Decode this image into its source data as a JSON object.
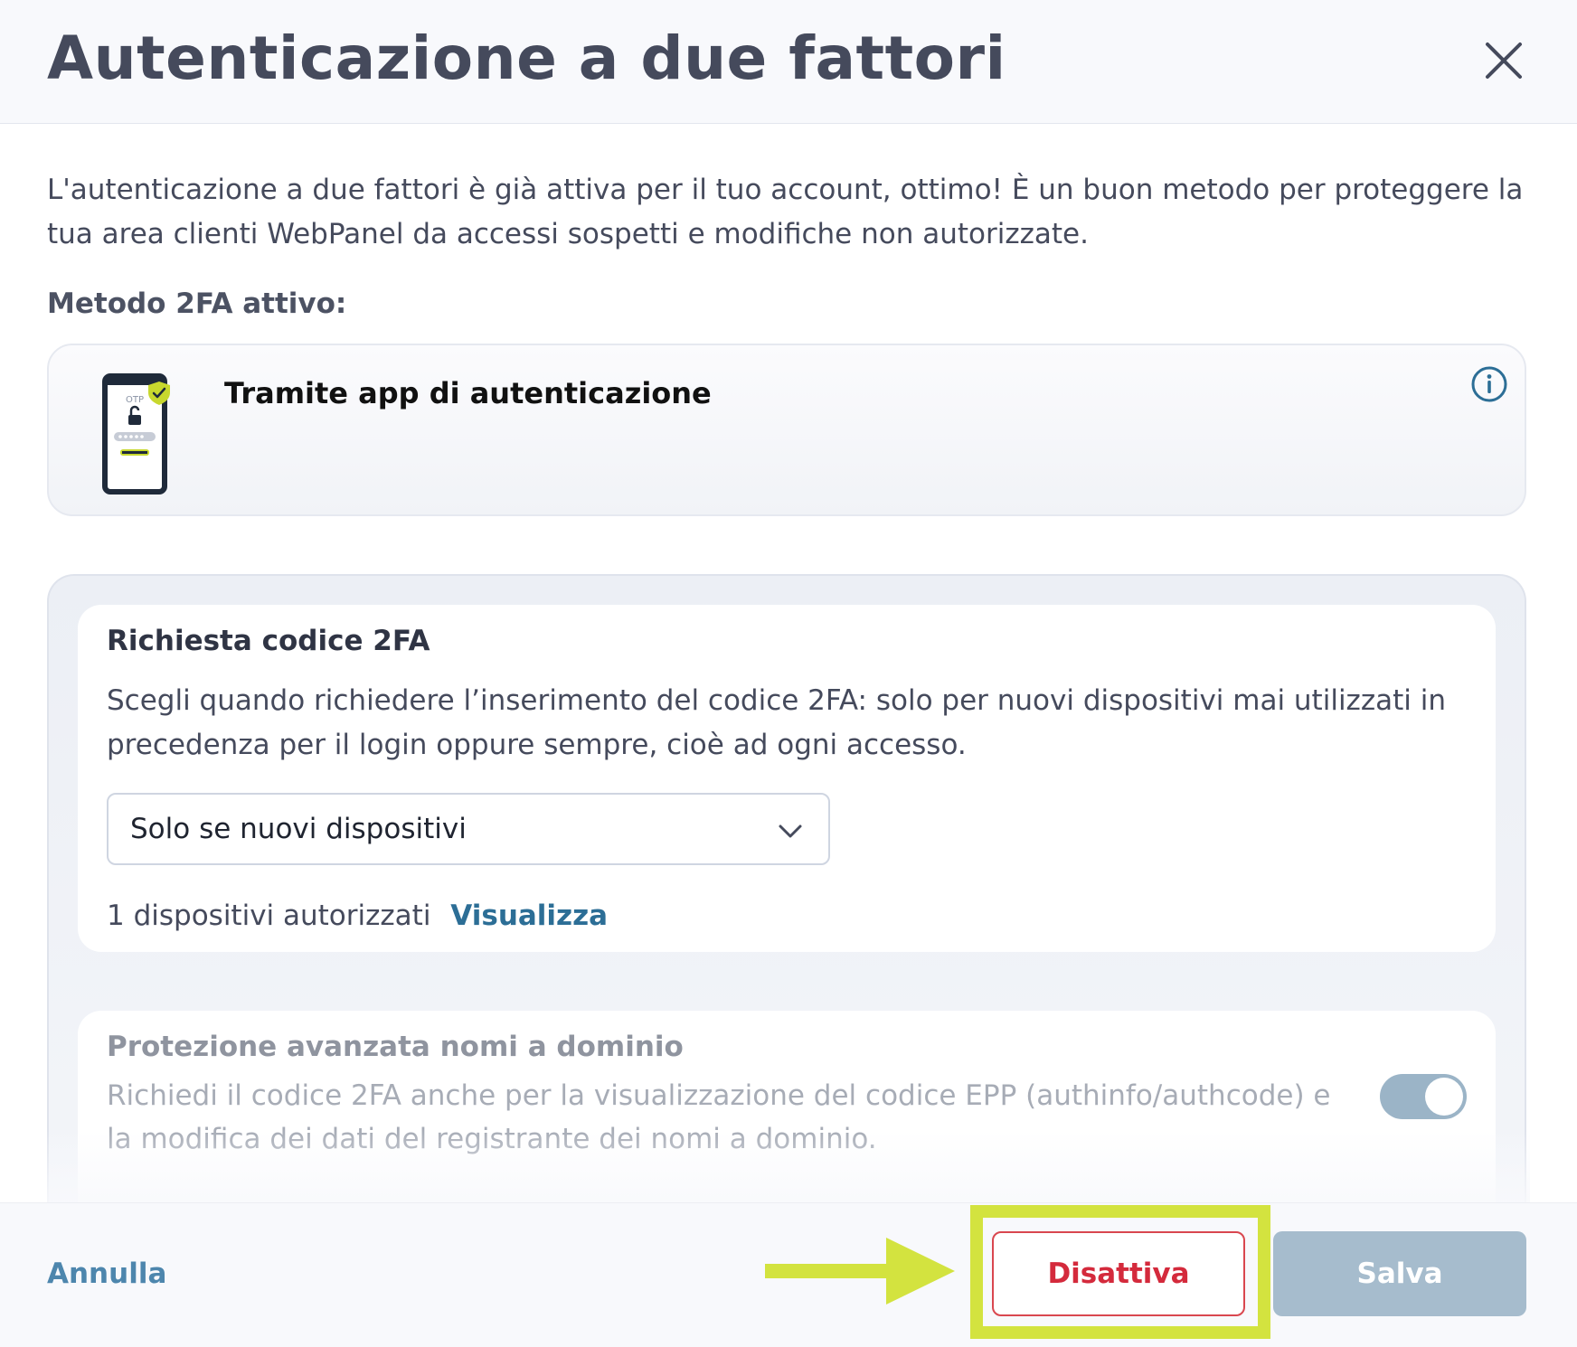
{
  "modal": {
    "title": "Autenticazione a due fattori",
    "close_icon": "close-icon",
    "intro": "L'autenticazione a due fattori è già attiva per il tuo account, ottimo! È un buon metodo per proteggere la tua area clienti WebPanel da accessi sospetti e modifiche non autorizzate."
  },
  "active_method": {
    "label": "Metodo 2FA attivo:",
    "title": "Tramite app di autenticazione",
    "icon": "phone-otp-icon",
    "icon_text": "OTP",
    "info_icon": "info-icon"
  },
  "code_request": {
    "title": "Richiesta codice 2FA",
    "description": "Scegli quando richiedere l’inserimento del codice 2FA: solo per nuovi dispositivi mai utilizzati in precedenza per il login oppure sempre, cioè ad ogni accesso.",
    "select_value": "Solo se nuovi dispositivi",
    "devices_text": "1 dispositivi autorizzati",
    "view_link": "Visualizza"
  },
  "domain_protection": {
    "title": "Protezione avanzata nomi a dominio",
    "description": "Richiedi il codice 2FA anche per la visualizzazione del codice EPP (authinfo/authcode) e la modifica dei dati del registrante dei nomi a dominio.",
    "toggle_on": true
  },
  "footer": {
    "cancel": "Annulla",
    "deactivate": "Disattiva",
    "save": "Salva"
  },
  "colors": {
    "annotation_highlight": "#d3e33f",
    "danger": "#d42a3c",
    "link": "#2c6e96",
    "save_disabled": "#a6bccd"
  }
}
